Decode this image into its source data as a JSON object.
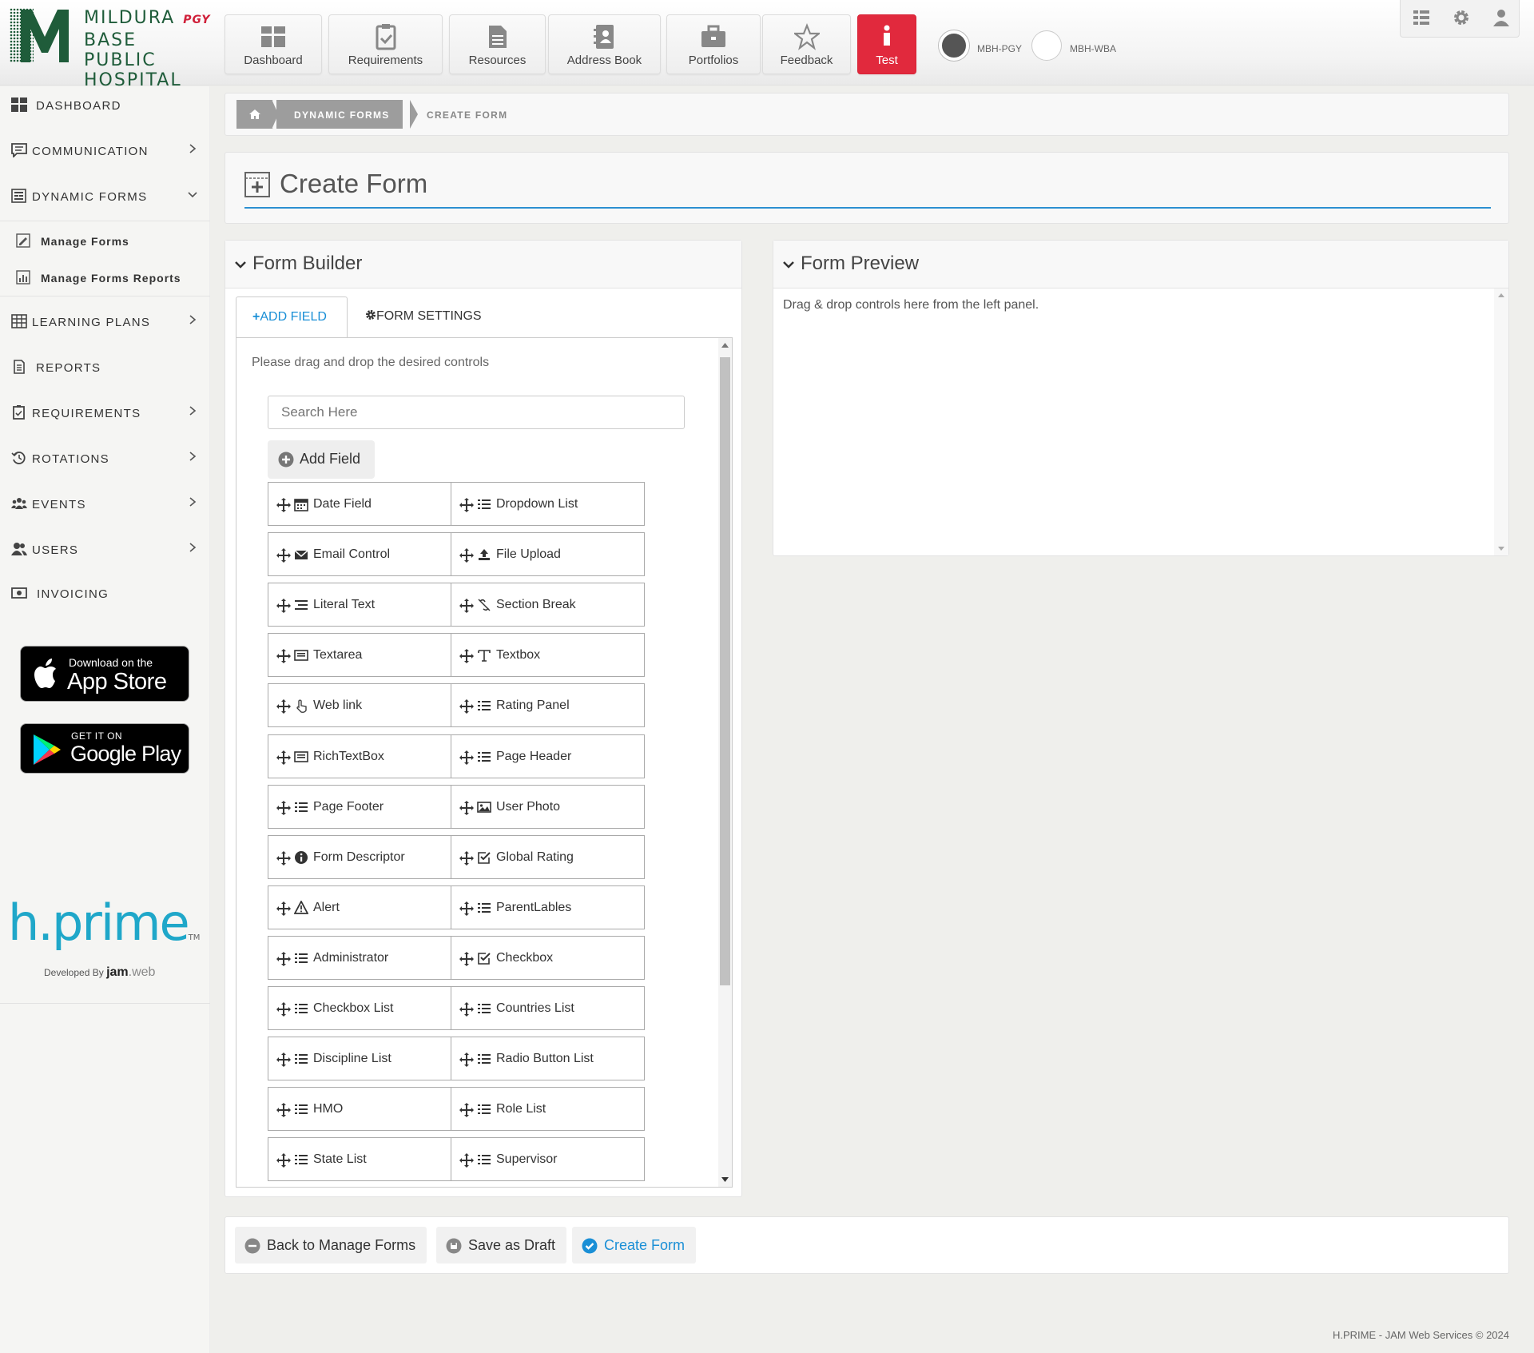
{
  "app": {
    "logo_line1": "MILDURA",
    "logo_tag": "PGY",
    "logo_line2": "BASE PUBLIC",
    "logo_line3": "HOSPITAL"
  },
  "nav": [
    {
      "label": "Dashboard",
      "icon": "dashboard-icon"
    },
    {
      "label": "Requirements",
      "icon": "clipboard-icon"
    },
    {
      "label": "Resources",
      "icon": "document-icon"
    },
    {
      "label": "Address Book",
      "icon": "address-book-icon"
    },
    {
      "label": "Portfolios",
      "icon": "briefcase-icon"
    },
    {
      "label": "Feedback",
      "icon": "star-icon"
    },
    {
      "label": "Test",
      "icon": "info-icon"
    }
  ],
  "instances": [
    {
      "label": "MBH-PGY",
      "selected": true
    },
    {
      "label": "MBH-WBA",
      "selected": false
    }
  ],
  "sidebar": {
    "items": [
      {
        "label": "DASHBOARD",
        "icon": "grid-icon"
      },
      {
        "label": "COMMUNICATION",
        "icon": "chat-icon"
      },
      {
        "label": "DYNAMIC FORMS",
        "icon": "form-icon"
      },
      {
        "label": "LEARNING PLANS",
        "icon": "table-icon"
      },
      {
        "label": "REPORTS",
        "icon": "report-icon"
      },
      {
        "label": "REQUIREMENTS",
        "icon": "clipboard-icon"
      },
      {
        "label": "ROTATIONS",
        "icon": "history-icon"
      },
      {
        "label": "EVENTS",
        "icon": "group-icon"
      },
      {
        "label": "USERS",
        "icon": "users-icon"
      },
      {
        "label": "INVOICING",
        "icon": "money-icon"
      }
    ],
    "subitems": [
      {
        "label": "Manage Forms"
      },
      {
        "label": "Manage Forms Reports"
      }
    ],
    "appstore_small": "Download on the",
    "appstore_big": "App Store",
    "googleplay_small": "GET IT ON",
    "googleplay_big": "Google Play",
    "brand": "h.prime",
    "brand_tm": "TM",
    "developed_by": "Developed By",
    "dev_brand": "jam",
    "dev_brand_suffix": ".web"
  },
  "breadcrumb": {
    "section": "DYNAMIC FORMS",
    "current": "CREATE FORM"
  },
  "page": {
    "title": "Create Form"
  },
  "builder": {
    "title": "Form Builder",
    "tab_add": "ADD FIELD",
    "tab_settings": "FORM SETTINGS",
    "hint": "Please drag and drop the desired controls",
    "search_placeholder": "Search Here",
    "add_field": "Add Field",
    "controls": [
      {
        "label": "Date Field",
        "icon": "calendar-icon"
      },
      {
        "label": "Dropdown List",
        "icon": "list-icon"
      },
      {
        "label": "Email Control",
        "icon": "envelope-icon"
      },
      {
        "label": "File Upload",
        "icon": "upload-icon"
      },
      {
        "label": "Literal Text",
        "icon": "text-list-icon"
      },
      {
        "label": "Section Break",
        "icon": "section-break-icon"
      },
      {
        "label": "Textarea",
        "icon": "textarea-icon"
      },
      {
        "label": "Textbox",
        "icon": "text-cursor-icon"
      },
      {
        "label": "Web link",
        "icon": "hand-pointer-icon"
      },
      {
        "label": "Rating Panel",
        "icon": "list-icon"
      },
      {
        "label": "RichTextBox",
        "icon": "textarea-icon"
      },
      {
        "label": "Page Header",
        "icon": "list-icon"
      },
      {
        "label": "Page Footer",
        "icon": "list-icon"
      },
      {
        "label": "User Photo",
        "icon": "image-icon"
      },
      {
        "label": "Form Descriptor",
        "icon": "info-circle-icon"
      },
      {
        "label": "Global Rating",
        "icon": "check-square-icon"
      },
      {
        "label": "Alert",
        "icon": "warning-icon"
      },
      {
        "label": "ParentLables",
        "icon": "list-icon"
      },
      {
        "label": "Administrator",
        "icon": "list-icon"
      },
      {
        "label": "Checkbox",
        "icon": "check-square-icon"
      },
      {
        "label": "Checkbox List",
        "icon": "list-icon"
      },
      {
        "label": "Countries List",
        "icon": "list-icon"
      },
      {
        "label": "Discipline List",
        "icon": "list-icon"
      },
      {
        "label": "Radio Button List",
        "icon": "list-icon"
      },
      {
        "label": "HMO",
        "icon": "list-icon"
      },
      {
        "label": "Role List",
        "icon": "list-icon"
      },
      {
        "label": "State List",
        "icon": "list-icon"
      },
      {
        "label": "Supervisor",
        "icon": "list-icon"
      }
    ]
  },
  "preview": {
    "title": "Form Preview",
    "empty_text": "Drag & drop controls here from the left panel."
  },
  "actions": {
    "back": "Back to Manage Forms",
    "draft": "Save as Draft",
    "create": "Create Form"
  },
  "footer": {
    "text": "H.PRIME - JAM Web Services © 2024"
  },
  "colors": {
    "accent": "#1a8fd6",
    "danger": "#e1293d",
    "brand_green": "#1f5c3a"
  }
}
